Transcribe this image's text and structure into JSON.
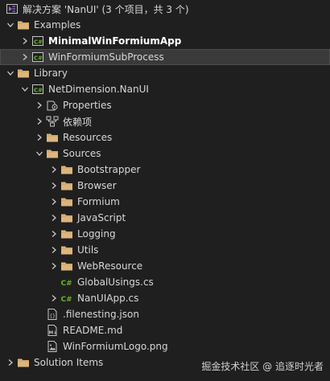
{
  "rows": [
    {
      "label": "解决方案 'NanUI' (3 个项目，共 3 个)",
      "icon": "solution-icon",
      "chevron": "none",
      "level": 0
    },
    {
      "label": "Examples",
      "icon": "folder-icon",
      "chevron": "down",
      "level": 0
    },
    {
      "label": "MinimalWinFormiumApp",
      "icon": "csharp-project-icon",
      "chevron": "right",
      "level": 1,
      "bold": true
    },
    {
      "label": "WinFormiumSubProcess",
      "icon": "csharp-project-icon",
      "chevron": "right",
      "level": 1,
      "selected": true
    },
    {
      "label": "Library",
      "icon": "folder-icon",
      "chevron": "down",
      "level": 0
    },
    {
      "label": "NetDimension.NanUI",
      "icon": "csharp-project-icon",
      "chevron": "down",
      "level": 1
    },
    {
      "label": "Properties",
      "icon": "properties-icon",
      "chevron": "right",
      "level": 2
    },
    {
      "label": "依赖项",
      "icon": "dependencies-icon",
      "chevron": "right",
      "level": 2
    },
    {
      "label": "Resources",
      "icon": "folder-icon",
      "chevron": "right",
      "level": 2
    },
    {
      "label": "Sources",
      "icon": "folder-icon",
      "chevron": "down",
      "level": 2
    },
    {
      "label": "Bootstrapper",
      "icon": "folder-icon",
      "chevron": "right",
      "level": 3
    },
    {
      "label": "Browser",
      "icon": "folder-icon",
      "chevron": "right",
      "level": 3
    },
    {
      "label": "Formium",
      "icon": "folder-icon",
      "chevron": "right",
      "level": 3
    },
    {
      "label": "JavaScript",
      "icon": "folder-icon",
      "chevron": "right",
      "level": 3
    },
    {
      "label": "Logging",
      "icon": "folder-icon",
      "chevron": "right",
      "level": 3
    },
    {
      "label": "Utils",
      "icon": "folder-icon",
      "chevron": "right",
      "level": 3
    },
    {
      "label": "WebResource",
      "icon": "folder-icon",
      "chevron": "right",
      "level": 3
    },
    {
      "label": "GlobalUsings.cs",
      "icon": "csharp-file-icon",
      "chevron": "none",
      "level": 3
    },
    {
      "label": "NanUIApp.cs",
      "icon": "csharp-file-icon",
      "chevron": "right",
      "level": 3
    },
    {
      "label": ".filenesting.json",
      "icon": "json-file-icon",
      "chevron": "none",
      "level": 2
    },
    {
      "label": "README.md",
      "icon": "markdown-file-icon",
      "chevron": "none",
      "level": 2
    },
    {
      "label": "WinFormiumLogo.png",
      "icon": "image-file-icon",
      "chevron": "none",
      "level": 2
    },
    {
      "label": "Solution Items",
      "icon": "folder-icon",
      "chevron": "right",
      "level": 0
    }
  ],
  "watermark": "掘金技术社区 @ 追逐时光者",
  "colors": {
    "background": "#1f1f1f",
    "folder": "#dcb67a",
    "csharp": "#68b723",
    "selected": "#3a3a3a"
  }
}
